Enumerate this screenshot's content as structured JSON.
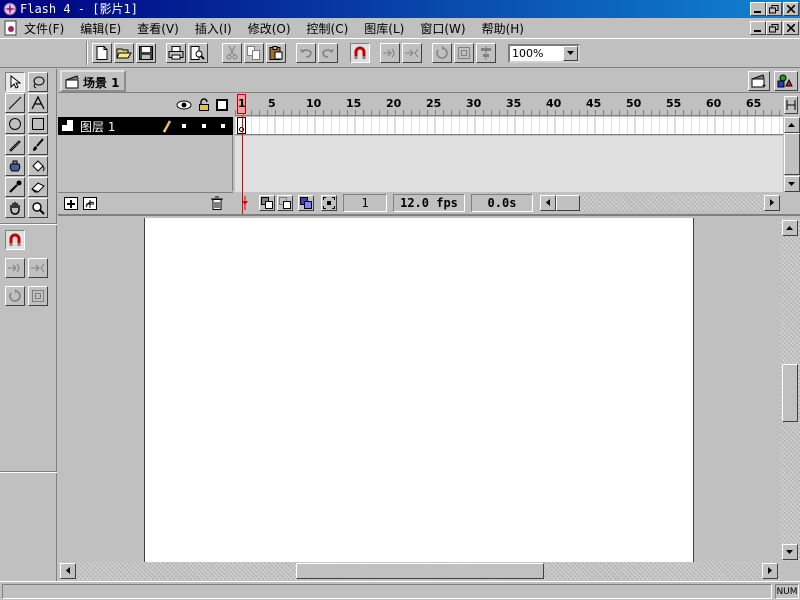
{
  "window": {
    "title": "Flash 4 - [影片1]"
  },
  "menu": {
    "items": [
      "文件(F)",
      "编辑(E)",
      "查看(V)",
      "插入(I)",
      "修改(O)",
      "控制(C)",
      "图库(L)",
      "窗口(W)",
      "帮助(H)"
    ]
  },
  "toolbar": {
    "zoom": "100%"
  },
  "scene": {
    "label": "场景 1"
  },
  "timeline": {
    "frame_numbers": [
      "1",
      "5",
      "10",
      "15",
      "20",
      "25",
      "30",
      "35",
      "40",
      "45",
      "50",
      "55",
      "60",
      "65"
    ],
    "layer_name": "图层 1",
    "current_frame": "1",
    "fps": "12.0 fps",
    "elapsed": "0.0s"
  },
  "status": {
    "num": "NUM"
  }
}
